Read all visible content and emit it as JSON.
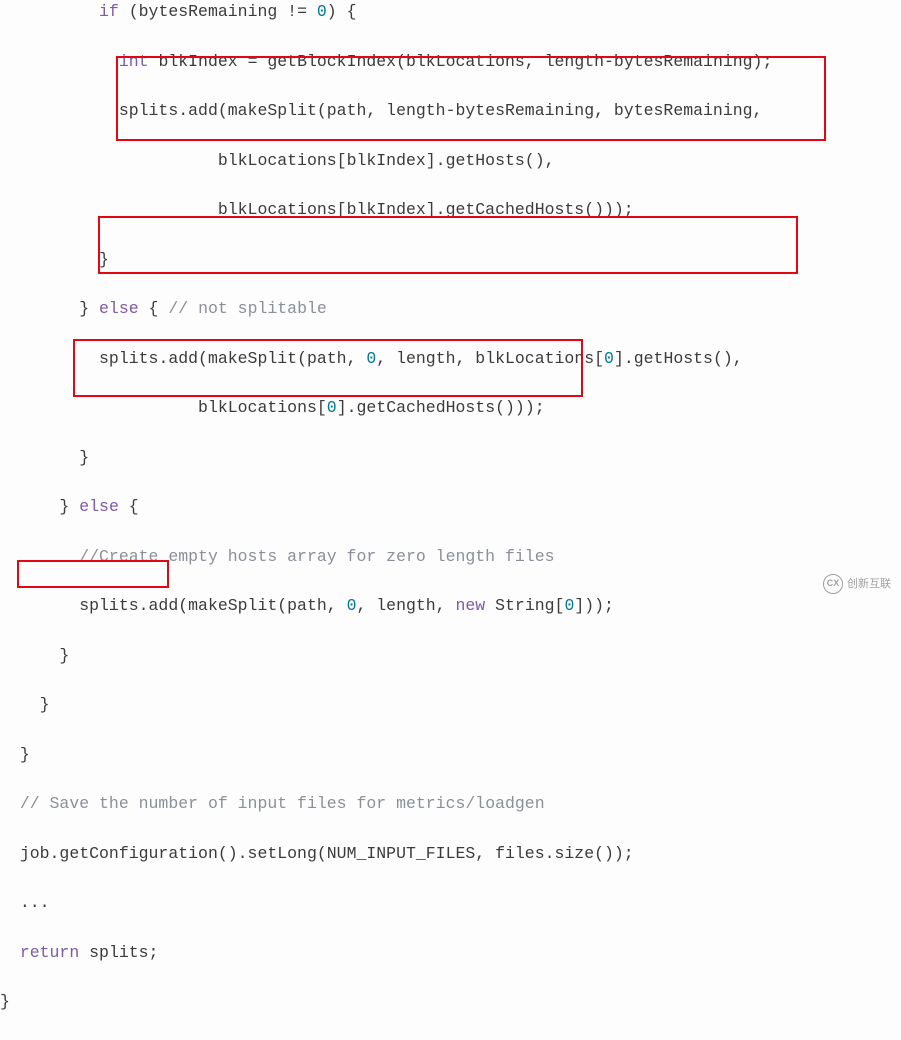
{
  "code": {
    "l1": [
      "if",
      " (bytesRemaining != ",
      "0",
      ") {"
    ],
    "l2": [
      "int",
      " blkIndex = getBlockIndex(blkLocations, length-bytesRemaining);"
    ],
    "l3": "splits.add(makeSplit(path, length-bytesRemaining, bytesRemaining,",
    "l4": "blkLocations[blkIndex].getHosts(),",
    "l5": "blkLocations[blkIndex].getCachedHosts()));",
    "l6": "}",
    "l7_a": "} ",
    "l7_b": "else",
    "l7_c": " { ",
    "l7_d": "// not splitable",
    "l8_a": "splits.add(makeSplit(path, ",
    "l8_b": "0",
    "l8_c": ", length, blkLocations[",
    "l8_d": "0",
    "l8_e": "].getHosts(),",
    "l9_a": "blkLocations[",
    "l9_b": "0",
    "l9_c": "].getCachedHosts()));",
    "l10": "}",
    "l11_a": "} ",
    "l11_b": "else",
    "l11_c": " {",
    "l12": "//Create empty hosts array for zero length files",
    "l13_a": "splits.add(makeSplit(path, ",
    "l13_b": "0",
    "l13_c": ", length, ",
    "l13_d": "new",
    "l13_e": " String[",
    "l13_f": "0",
    "l13_g": "]));",
    "l14": "}",
    "l15": "}",
    "l16": "}",
    "l17": "// Save the number of input files for metrics/loadgen",
    "l18": "job.getConfiguration().setLong(NUM_INPUT_FILES, files.size());",
    "l19": "...",
    "l20_a": "return",
    "l20_b": " splits;",
    "l21": "}"
  },
  "watermark": {
    "logo": "CX",
    "text": "创新互联"
  }
}
